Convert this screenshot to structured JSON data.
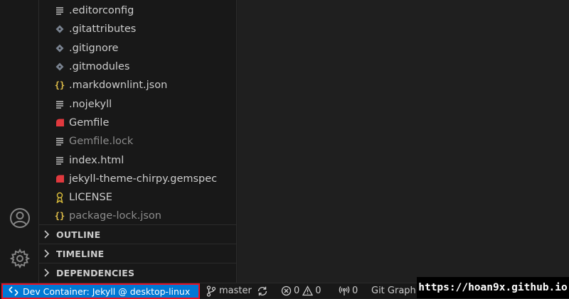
{
  "explorer": {
    "files": [
      {
        "name": ".editorconfig",
        "icon": "lines-icon",
        "dim": false
      },
      {
        "name": ".gitattributes",
        "icon": "git-diamond-icon",
        "dim": false
      },
      {
        "name": ".gitignore",
        "icon": "git-diamond-icon",
        "dim": false
      },
      {
        "name": ".gitmodules",
        "icon": "git-diamond-icon",
        "dim": false
      },
      {
        "name": ".markdownlint.json",
        "icon": "json-braces-icon",
        "dim": false
      },
      {
        "name": ".nojekyll",
        "icon": "lines-icon",
        "dim": false
      },
      {
        "name": "Gemfile",
        "icon": "ruby-icon",
        "dim": false
      },
      {
        "name": "Gemfile.lock",
        "icon": "lines-icon",
        "dim": true
      },
      {
        "name": "index.html",
        "icon": "lines-icon",
        "dim": false
      },
      {
        "name": "jekyll-theme-chirpy.gemspec",
        "icon": "ruby-icon",
        "dim": false
      },
      {
        "name": "LICENSE",
        "icon": "license-ribbon-icon",
        "dim": false
      },
      {
        "name": "package-lock.json",
        "icon": "json-braces-icon",
        "dim": true
      }
    ],
    "sections": {
      "outline": "OUTLINE",
      "timeline": "TIMELINE",
      "dependencies": "DEPENDENCIES"
    }
  },
  "statusbar": {
    "remote": "Dev Container: Jekyll @ desktop-linux",
    "branch": "master",
    "errors": "0",
    "warnings": "0",
    "ports": "0",
    "git_graph": "Git Graph"
  },
  "watermark": "https://hoan9x.github.io",
  "colors": {
    "remote_bg": "#0078d4",
    "remote_border": "#e81123",
    "ruby": "#e0393e",
    "json": "#e2c04a",
    "git": "#7a8391",
    "license": "#d4b83a"
  }
}
